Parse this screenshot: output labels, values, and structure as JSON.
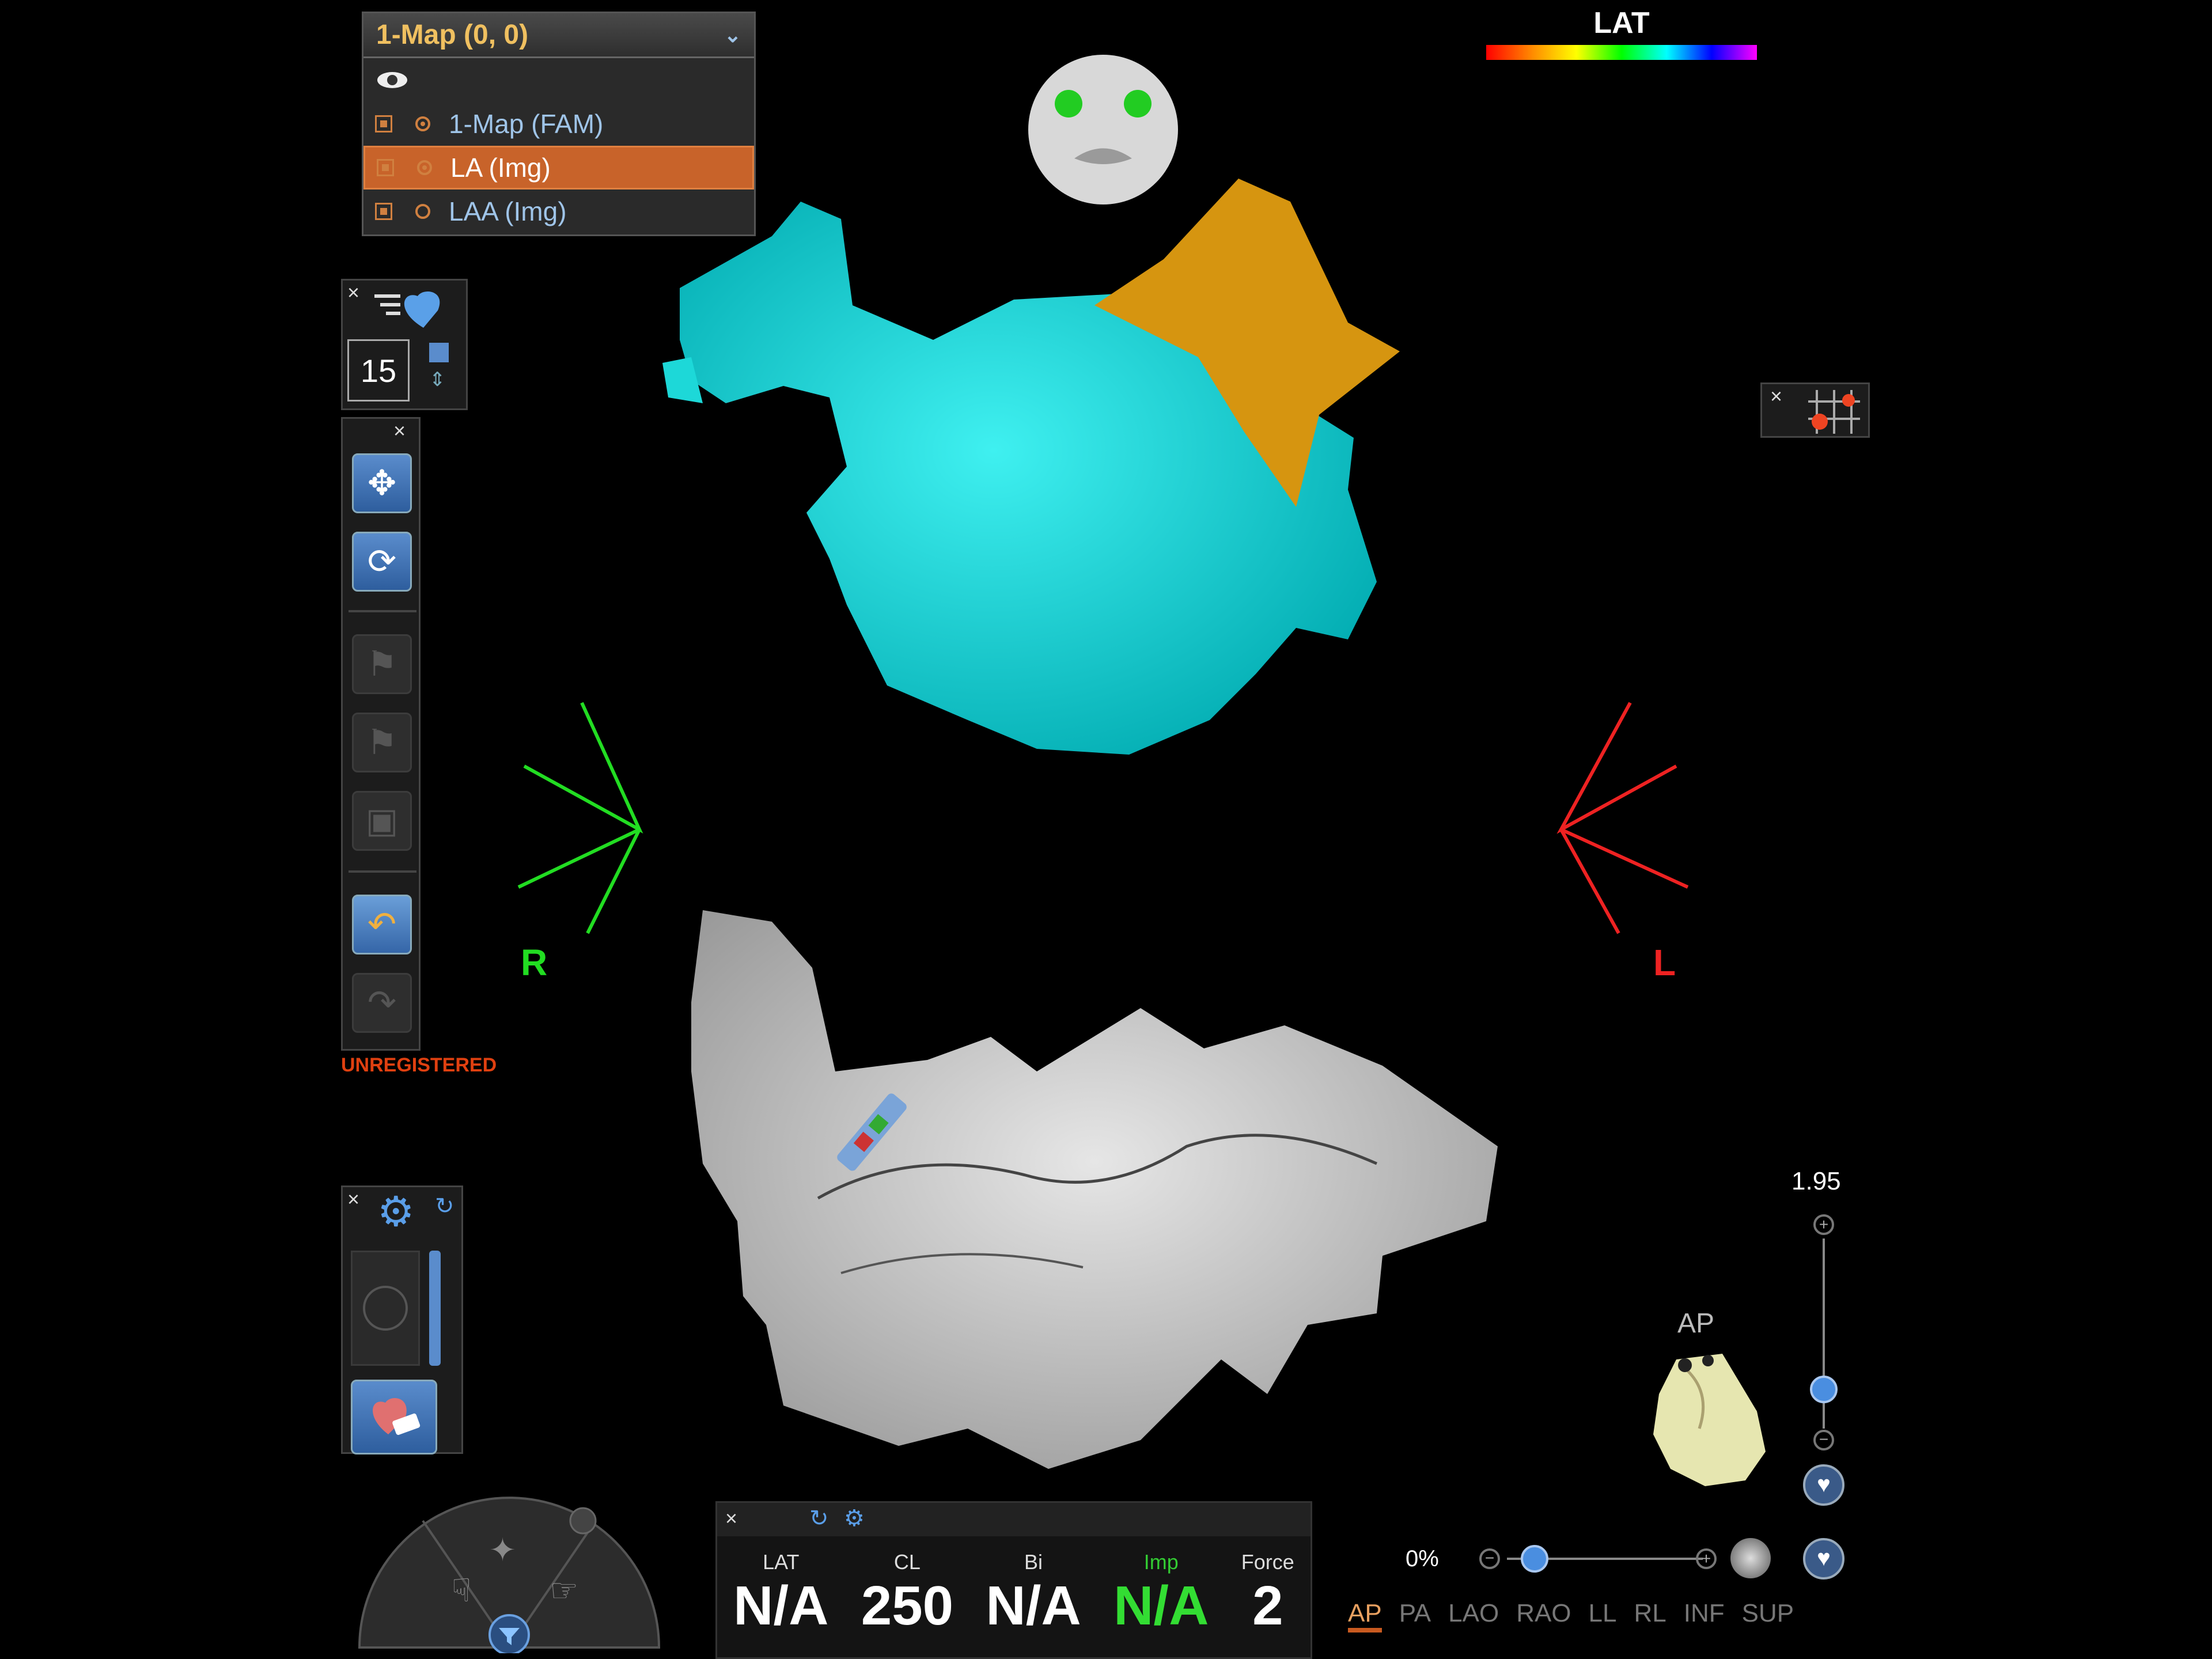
{
  "map_panel": {
    "title": "1-Map (0, 0)",
    "rows": [
      {
        "label": "1-Map (FAM)",
        "selected": false
      },
      {
        "label": "LA (Img)",
        "selected": true
      },
      {
        "label": "LAA (Img)",
        "selected": false
      }
    ]
  },
  "lat_legend": {
    "label": "LAT"
  },
  "segment_panel": {
    "value": "15"
  },
  "registration": {
    "status": "UNREGISTERED"
  },
  "orientation": {
    "right_label": "R",
    "left_label": "L"
  },
  "zoom": {
    "value": "1.95"
  },
  "view_cube": {
    "label": "AP"
  },
  "opacity": {
    "value": "0%"
  },
  "stats": [
    {
      "label": "LAT",
      "value": "N/A",
      "label_color": "#dddddd"
    },
    {
      "label": "CL",
      "value": "250",
      "label_color": "#dddddd"
    },
    {
      "label": "Bi",
      "value": "N/A",
      "label_color": "#dddddd"
    },
    {
      "label": "Imp",
      "value": "N/A",
      "label_color": "#33cc33"
    },
    {
      "label": "Force",
      "value": "2",
      "label_color": "#dddddd"
    }
  ],
  "view_tabs": [
    "AP",
    "PA",
    "LAO",
    "RAO",
    "LL",
    "RL",
    "INF",
    "SUP"
  ],
  "active_view": "AP",
  "colors": {
    "accent": "#c8632a",
    "lumen": "#00d6d6",
    "appendage": "#e0a020",
    "right": "#22dd22",
    "left": "#ee2222"
  }
}
